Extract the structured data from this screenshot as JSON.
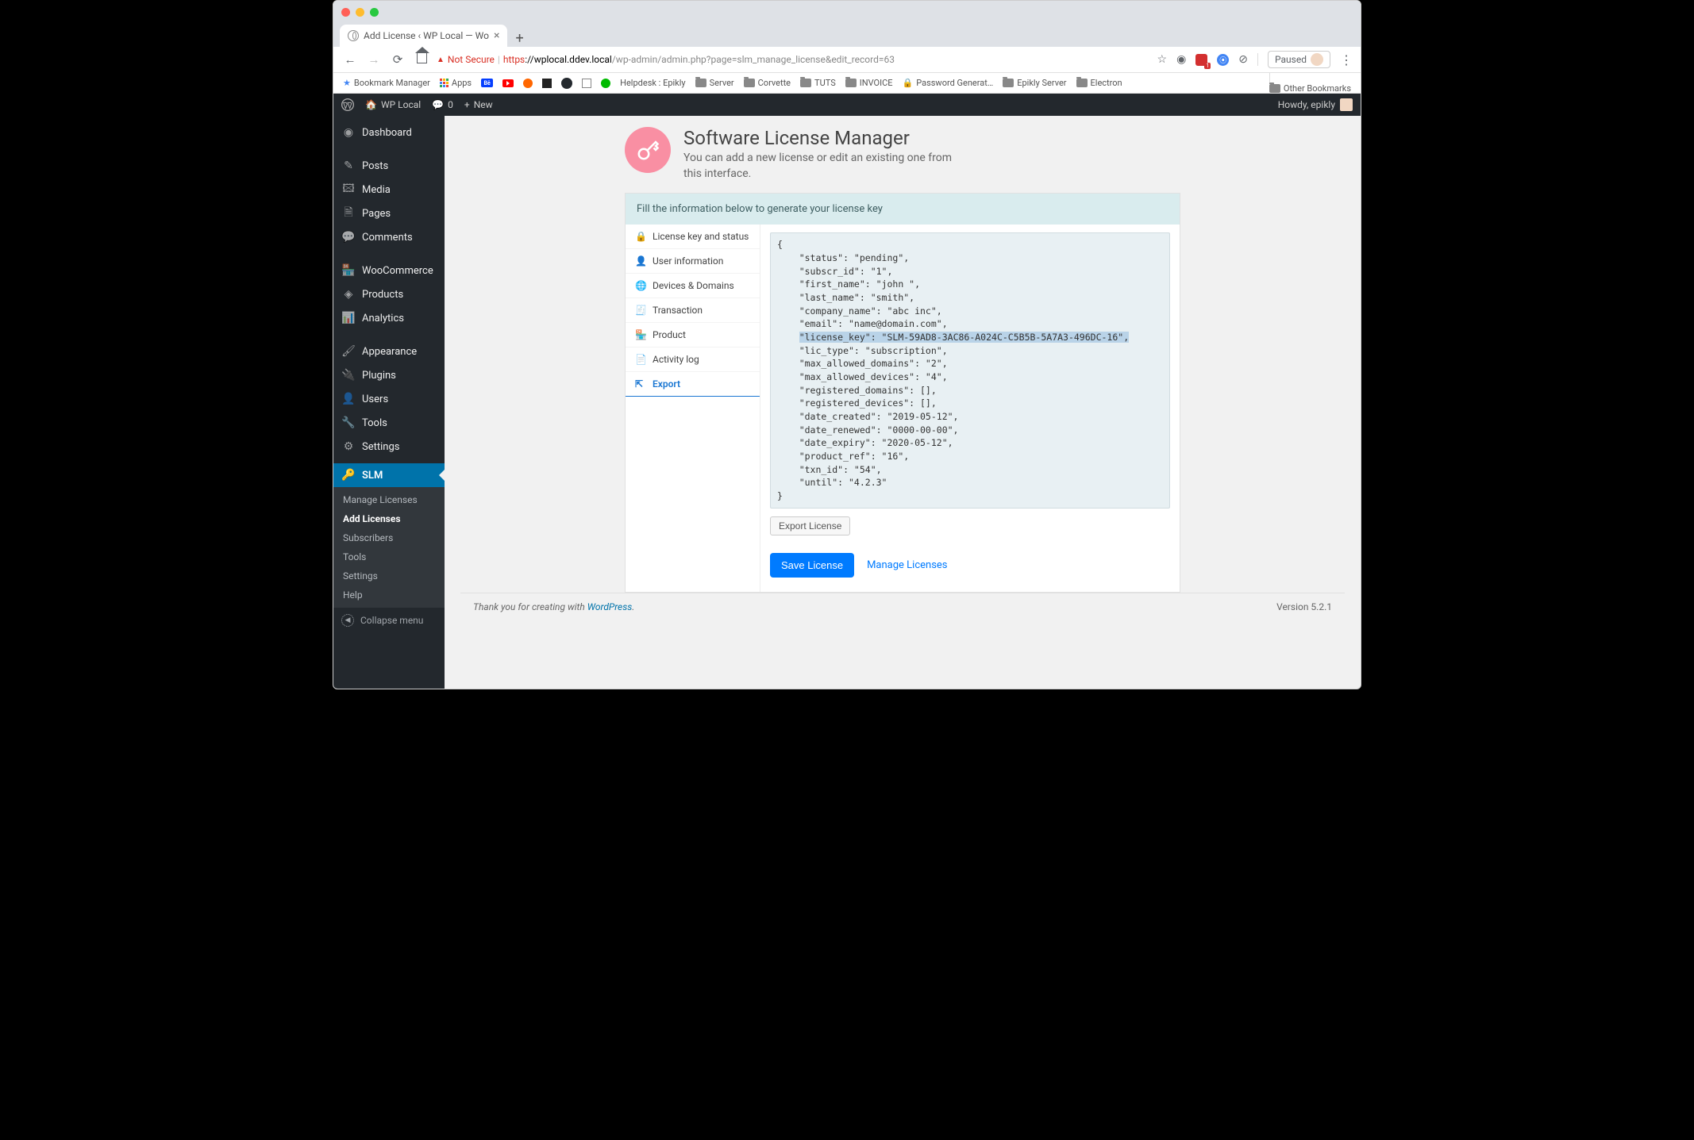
{
  "browser": {
    "tab_title": "Add License ‹ WP Local — Wo",
    "not_secure": "Not Secure",
    "url_proto": "https",
    "url_domain": "://wplocal.ddev.local",
    "url_path": "/wp-admin/admin.php?page=slm_manage_license&edit_record=63",
    "paused": "Paused",
    "bookmarks": [
      "Bookmark Manager",
      "Apps",
      "",
      "",
      "",
      "",
      "",
      "",
      "",
      "Helpdesk : Epikly",
      "Server",
      "Corvette",
      "TUTS",
      "INVOICE",
      "Password Generat…",
      "Epikly Server",
      "Electron"
    ],
    "other_bookmarks": "Other Bookmarks",
    "ublock_count": "1"
  },
  "adminbar": {
    "site": "WP Local",
    "comments": "0",
    "new": "New",
    "howdy": "Howdy, epikly"
  },
  "menu": {
    "dashboard": "Dashboard",
    "posts": "Posts",
    "media": "Media",
    "pages": "Pages",
    "comments": "Comments",
    "woocommerce": "WooCommerce",
    "products": "Products",
    "analytics": "Analytics",
    "appearance": "Appearance",
    "plugins": "Plugins",
    "users": "Users",
    "tools": "Tools",
    "settings": "Settings",
    "slm": "SLM",
    "collapse": "Collapse menu",
    "sub": {
      "manage": "Manage Licenses",
      "add": "Add Licenses",
      "subscribers": "Subscribers",
      "tools": "Tools",
      "settings": "Settings",
      "help": "Help"
    }
  },
  "page": {
    "title": "Software License Manager",
    "subtitle": "You can add a new license or edit an existing one from this interface.",
    "notice": "Fill the information below to generate your license key",
    "tabs": {
      "key_status": "License key and status",
      "user_info": "User information",
      "devices": "Devices & Domains",
      "transaction": "Transaction",
      "product": "Product",
      "activity": "Activity log",
      "export": "Export"
    },
    "export_btn": "Export License",
    "save_btn": "Save License",
    "manage_link": "Manage Licenses",
    "code_pre": "{\n    \"status\": \"pending\",\n    \"subscr_id\": \"1\",\n    \"first_name\": \"john \",\n    \"last_name\": \"smith\",\n    \"company_name\": \"abc inc\",\n    \"email\": \"name@domain.com\",\n    ",
    "code_hl": "\"license_key\": \"SLM-59AD8-3AC86-A024C-C5B5B-5A7A3-496DC-16\",",
    "code_post": "\n    \"lic_type\": \"subscription\",\n    \"max_allowed_domains\": \"2\",\n    \"max_allowed_devices\": \"4\",\n    \"registered_domains\": [],\n    \"registered_devices\": [],\n    \"date_created\": \"2019-05-12\",\n    \"date_renewed\": \"0000-00-00\",\n    \"date_expiry\": \"2020-05-12\",\n    \"product_ref\": \"16\",\n    \"txn_id\": \"54\",\n    \"until\": \"4.2.3\"\n}"
  },
  "footer": {
    "thank": "Thank you for creating with ",
    "wp": "WordPress",
    "version": "Version 5.2.1"
  }
}
